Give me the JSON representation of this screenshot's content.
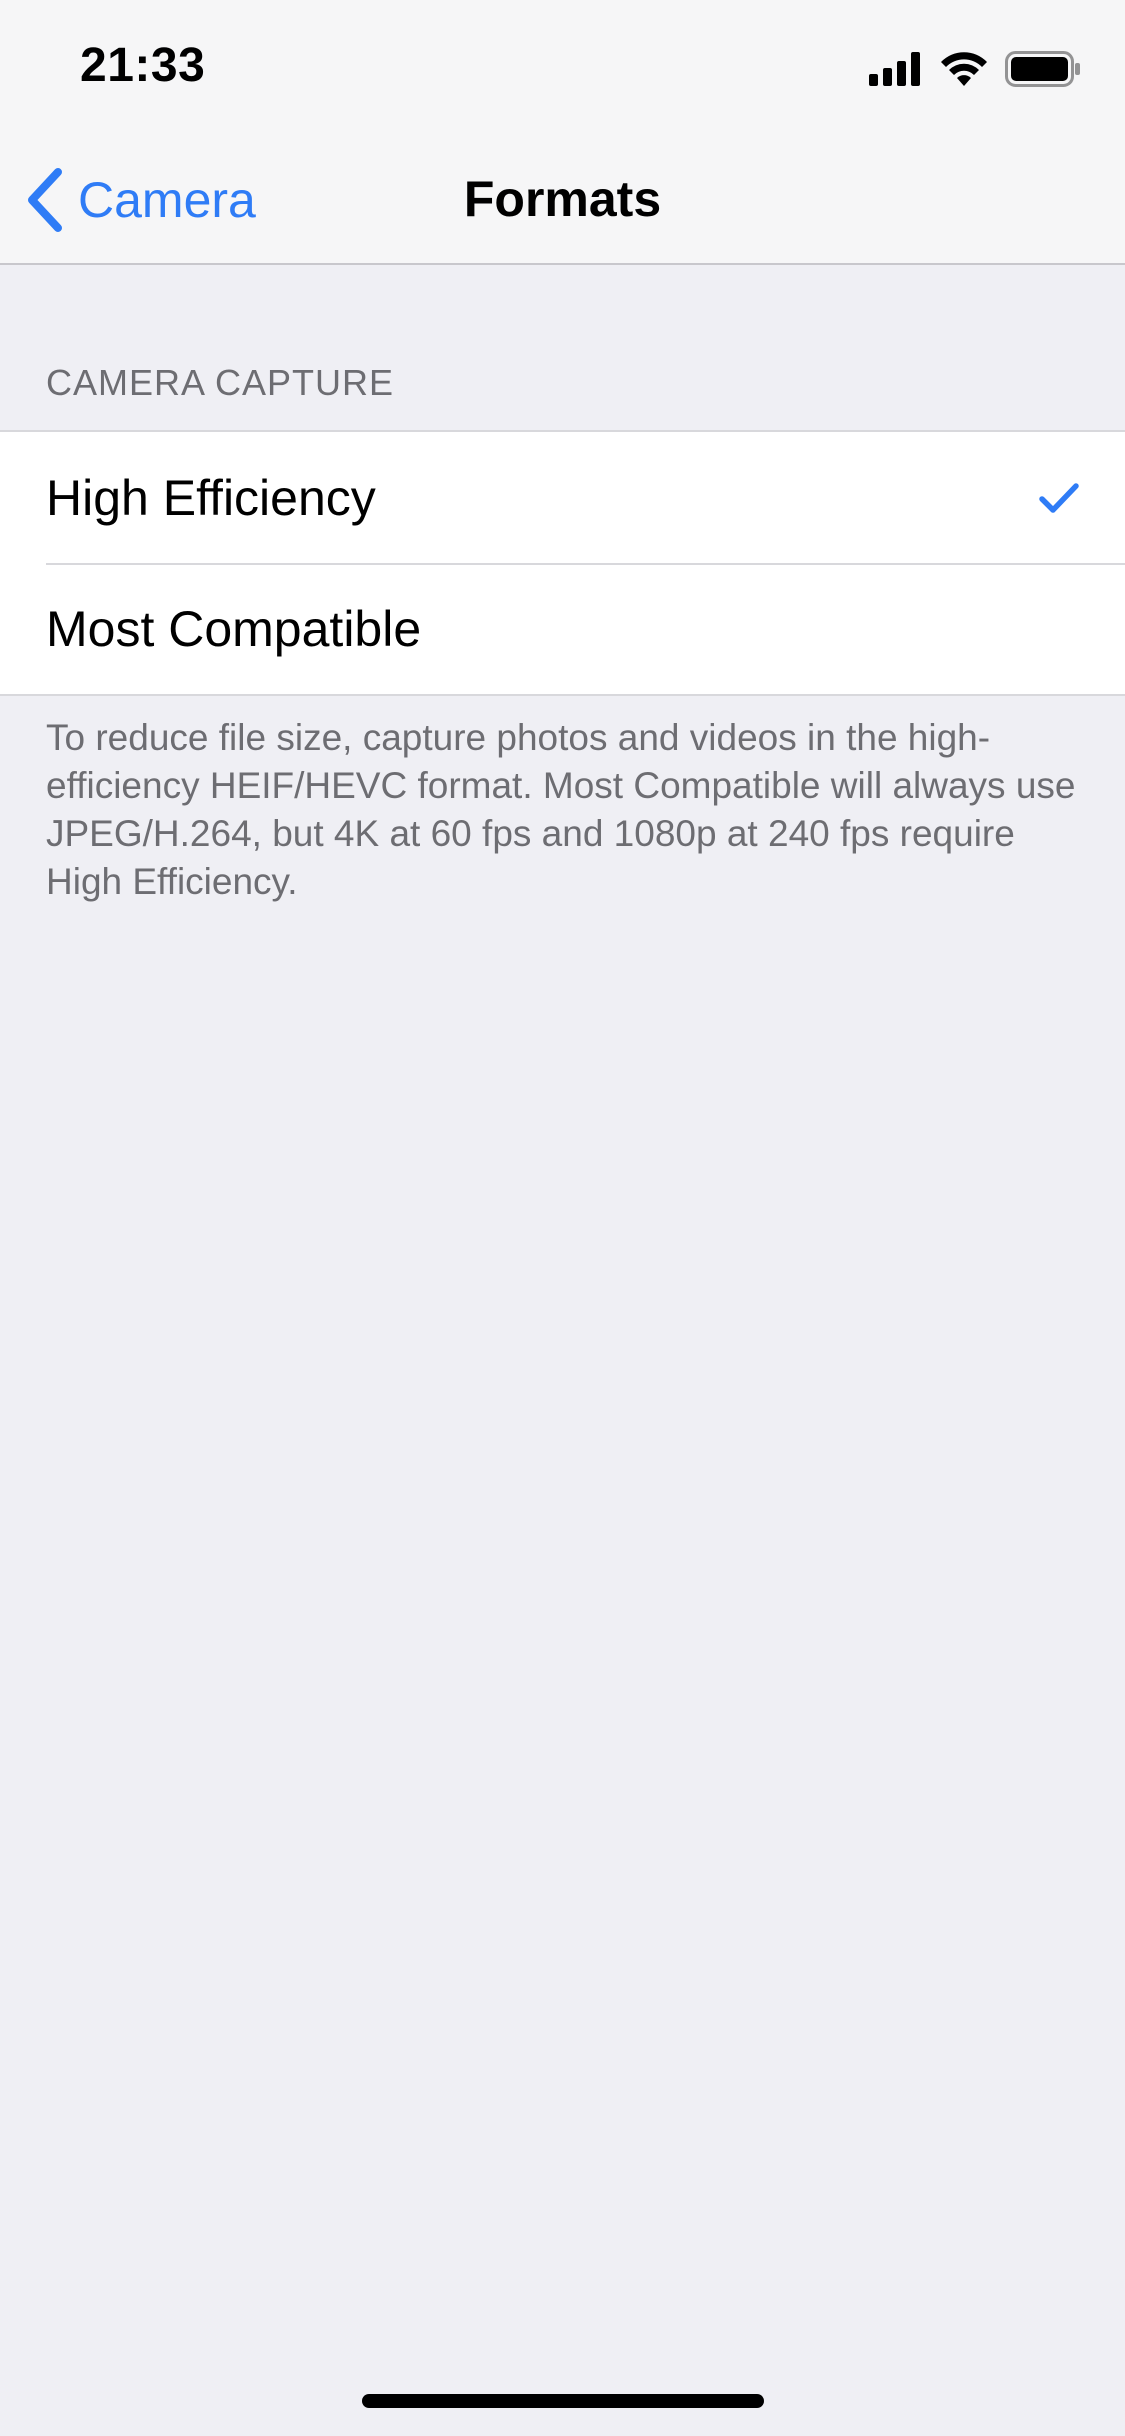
{
  "status_bar": {
    "time": "21:33",
    "icons": [
      "signal-icon",
      "wifi-icon",
      "battery-icon"
    ]
  },
  "nav": {
    "back_label": "Camera",
    "back_icon": "chevron-left-icon",
    "title": "Formats"
  },
  "section": {
    "header": "CAMERA CAPTURE",
    "options": [
      {
        "label": "High Efficiency",
        "selected": true
      },
      {
        "label": "Most Compatible",
        "selected": false
      }
    ],
    "footer": "To reduce file size, capture photos and videos in the high-efficiency HEIF/HEVC format. Most Compatible will always use JPEG/H.264, but 4K at 60 fps and 1080p at 240 fps require High Efficiency."
  },
  "colors": {
    "accent": "#2f7cf6",
    "background": "#efeff4",
    "secondary_text": "#6d6d72"
  }
}
